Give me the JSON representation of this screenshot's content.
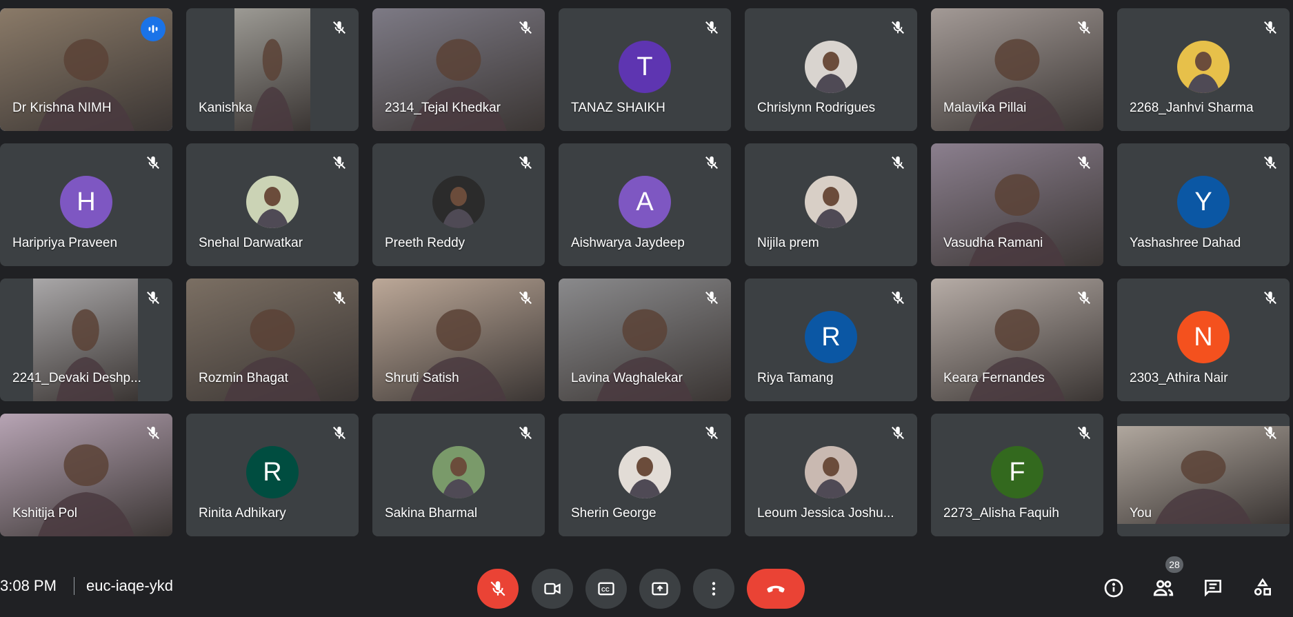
{
  "participants": [
    {
      "name": "Dr Krishna NIMH",
      "type": "video",
      "bg": "#8a7a68",
      "speaking": true
    },
    {
      "name": "Kanishka",
      "type": "video-narrow",
      "bg": "#9c9a94"
    },
    {
      "name": "2314_Tejal Khedkar",
      "type": "video",
      "bg": "#7d7a85"
    },
    {
      "name": "TANAZ SHAIKH",
      "type": "letter",
      "letter": "T",
      "color": "#5e35b1"
    },
    {
      "name": "Chrislynn Rodrigues",
      "type": "photo",
      "color": "#d9d4cf"
    },
    {
      "name": "Malavika Pillai",
      "type": "video",
      "bg": "#a39a96"
    },
    {
      "name": "2268_Janhvi Sharma",
      "type": "photo",
      "color": "#e7c04a"
    },
    {
      "name": "Haripriya Praveen",
      "type": "letter",
      "letter": "H",
      "color": "#7e57c2"
    },
    {
      "name": "Snehal Darwatkar",
      "type": "photo",
      "color": "#cbd3b5"
    },
    {
      "name": "Preeth Reddy",
      "type": "photo",
      "color": "#2b2b2b"
    },
    {
      "name": "Aishwarya Jaydeep",
      "type": "letter",
      "letter": "A",
      "color": "#7e57c2"
    },
    {
      "name": "Nijila prem",
      "type": "photo",
      "color": "#d8cfc6"
    },
    {
      "name": "Vasudha Ramani",
      "type": "video",
      "bg": "#8b7f8e"
    },
    {
      "name": "Yashashree Dahad",
      "type": "letter",
      "letter": "Y",
      "color": "#0b57a4"
    },
    {
      "name": "2241_Devaki Deshp...",
      "type": "video-narrow",
      "bg": "#a9a7a8"
    },
    {
      "name": "Rozmin Bhagat",
      "type": "video",
      "bg": "#7b6f63"
    },
    {
      "name": "Shruti Satish",
      "type": "video",
      "bg": "#bca898"
    },
    {
      "name": "Lavina Waghalekar",
      "type": "video",
      "bg": "#8a8a8c"
    },
    {
      "name": "Riya Tamang",
      "type": "letter",
      "letter": "R",
      "color": "#0b57a4"
    },
    {
      "name": "Keara Fernandes",
      "type": "video",
      "bg": "#b6aca6"
    },
    {
      "name": "2303_Athira Nair",
      "type": "letter",
      "letter": "N",
      "color": "#f4511e"
    },
    {
      "name": "Kshitija Pol",
      "type": "video",
      "bg": "#b7a4b4"
    },
    {
      "name": "Rinita Adhikary",
      "type": "letter",
      "letter": "R",
      "color": "#004d40"
    },
    {
      "name": "Sakina Bharmal",
      "type": "photo",
      "color": "#7a9a6a"
    },
    {
      "name": "Sherin George",
      "type": "photo",
      "color": "#e2dcd6"
    },
    {
      "name": "Leoum Jessica Joshu...",
      "type": "photo",
      "color": "#c9b9b1"
    },
    {
      "name": "2273_Alisha Faquih",
      "type": "letter",
      "letter": "F",
      "color": "#33691e"
    },
    {
      "name": "You",
      "type": "video-self",
      "bg": "#b0a79e"
    }
  ],
  "bottom_bar": {
    "time": "3:08 PM",
    "meeting_code": "euc-iaqe-ykd",
    "participant_count": "28"
  },
  "colors": {
    "background": "#202124",
    "tile": "#3c4043",
    "end_call": "#ea4335",
    "accent": "#8ab4f8"
  },
  "icons": {
    "mic_off": "mic-off-icon",
    "camera": "camera-icon",
    "captions": "captions-icon",
    "present": "present-icon",
    "more": "more-vert-icon",
    "end_call": "end-call-icon",
    "info": "info-icon",
    "people": "people-icon",
    "chat": "chat-icon",
    "activities": "activities-icon"
  }
}
